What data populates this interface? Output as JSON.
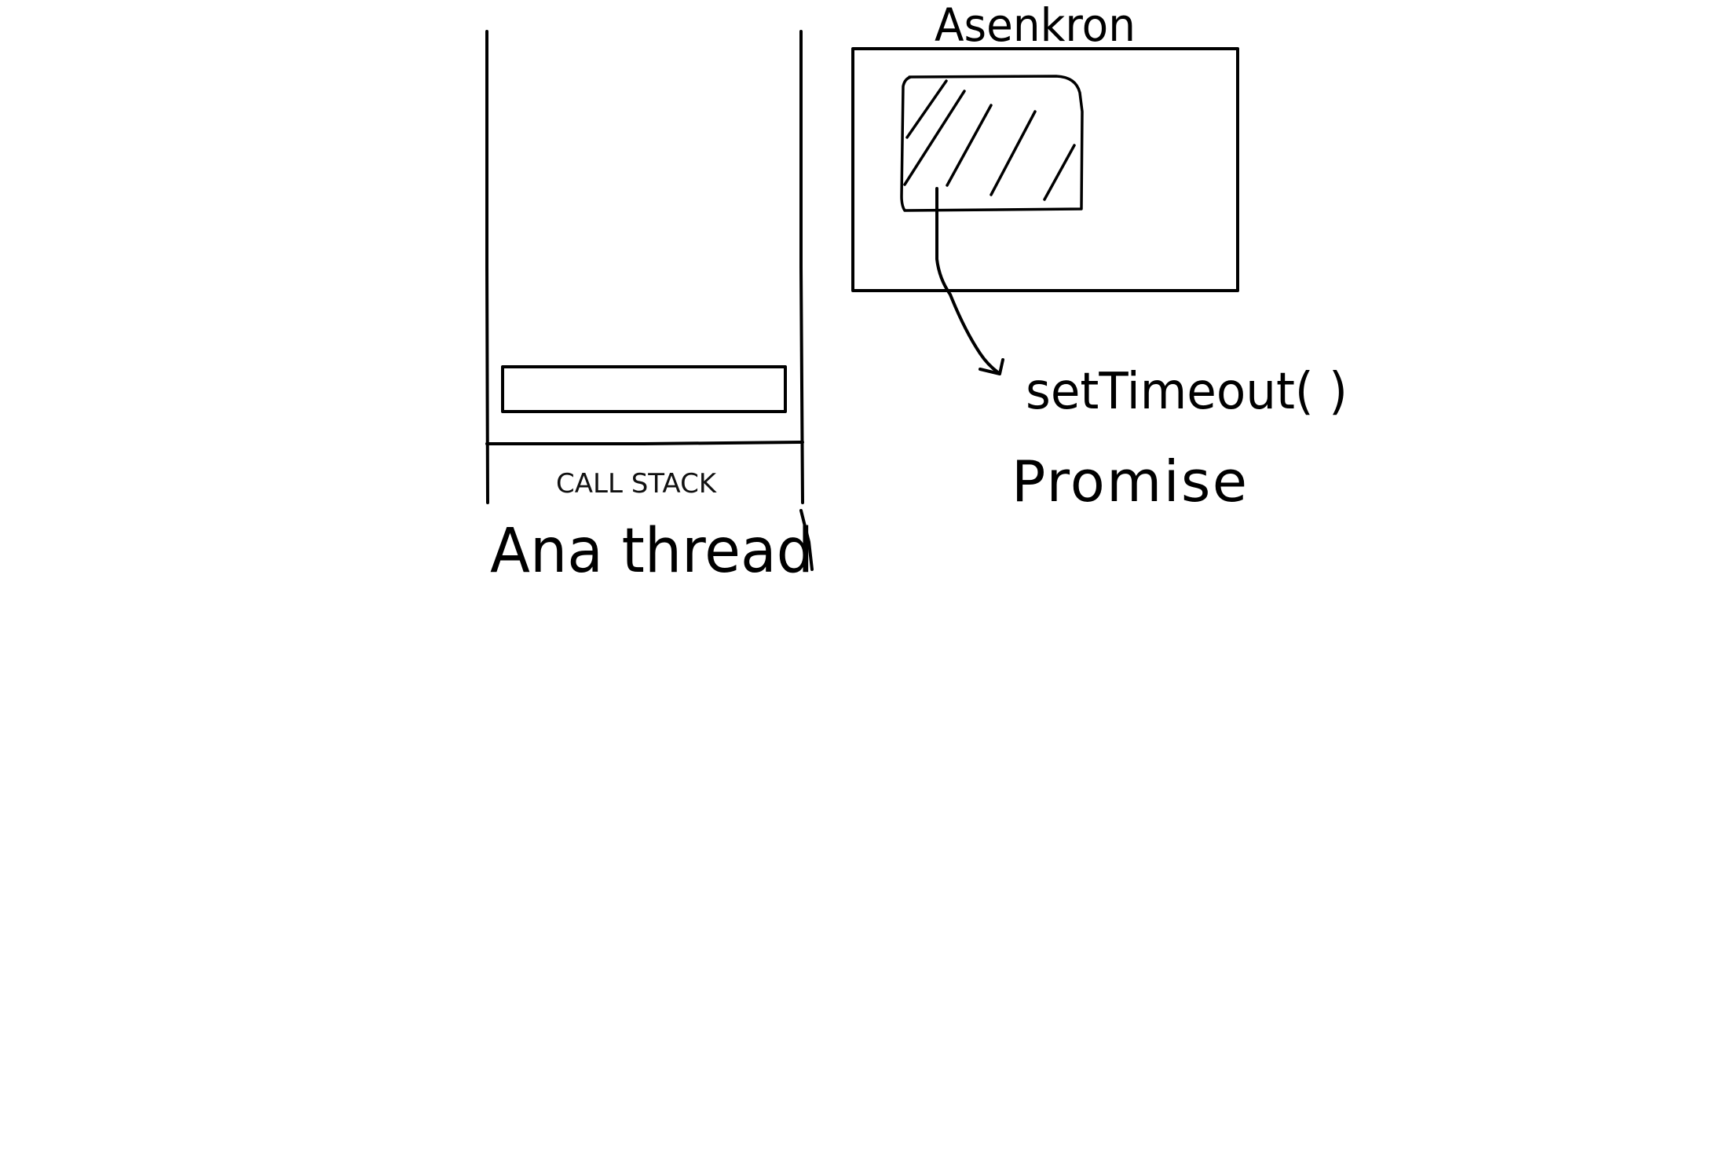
{
  "diagram": {
    "call_stack_label": "CALL STACK",
    "main_thread_label": "Ana thread",
    "async_area_label": "Asenkron",
    "async_items": [
      "setTimeout( )",
      "Promise"
    ],
    "colors": {
      "ink": "#000000",
      "background": "#ffffff"
    }
  }
}
